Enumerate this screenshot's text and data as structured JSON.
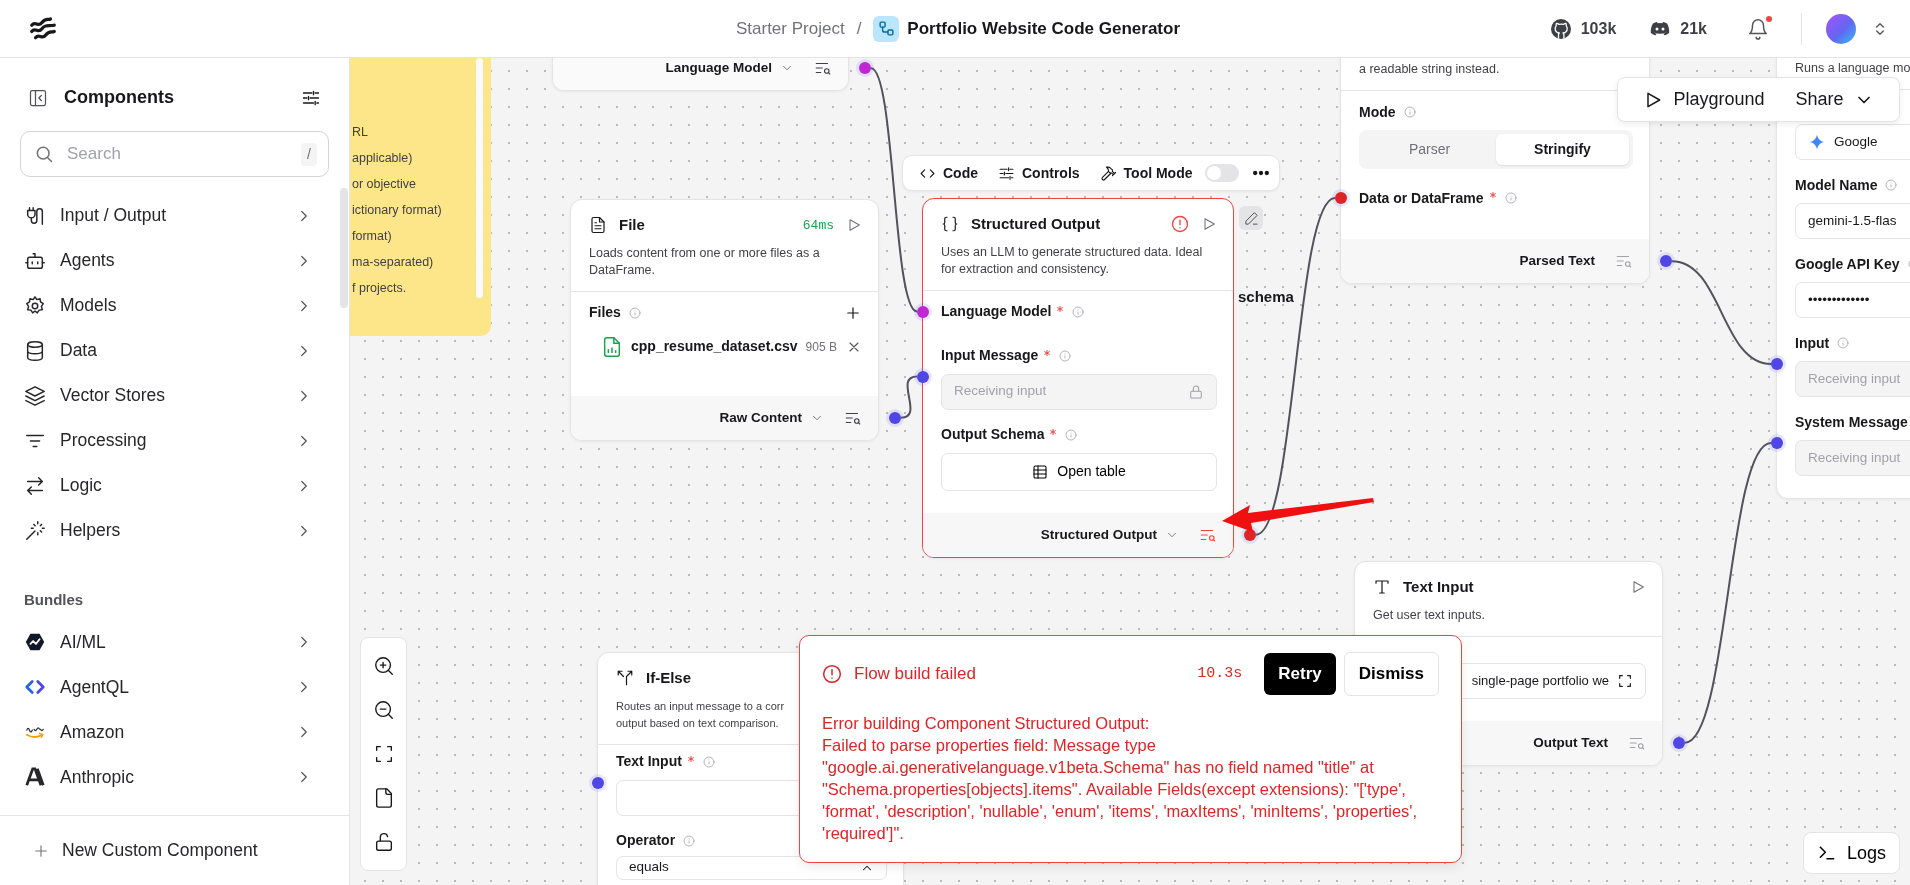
{
  "header": {
    "project": "Starter Project",
    "separator": "/",
    "flow_title": "Portfolio Website Code Generator",
    "github_count": "103k",
    "discord_count": "21k",
    "has_notification": true
  },
  "sidebar": {
    "title": "Components",
    "search": {
      "placeholder": "Search",
      "shortcut": "/"
    },
    "categories": [
      {
        "label": "Input / Output"
      },
      {
        "label": "Agents"
      },
      {
        "label": "Models"
      },
      {
        "label": "Data"
      },
      {
        "label": "Vector Stores"
      },
      {
        "label": "Processing"
      },
      {
        "label": "Logic"
      },
      {
        "label": "Helpers"
      }
    ],
    "bundles_title": "Bundles",
    "bundles": [
      {
        "label": "AI/ML"
      },
      {
        "label": "AgentQL"
      },
      {
        "label": "Amazon"
      },
      {
        "label": "Anthropic"
      }
    ],
    "new_component": "New Custom Component"
  },
  "canvas": {
    "note": {
      "lines": [
        "RL",
        "applicable)",
        "or objective",
        "ictionary format)",
        "format)",
        "ma-separated)",
        "f projects."
      ]
    },
    "toolbar": {
      "code": "Code",
      "controls": "Controls",
      "tool_mode": "Tool Mode",
      "tool_mode_on": false
    },
    "nodes": [
      {
        "output": {
          "label": "Language Model",
          "has_options": true,
          "color": "#c026d3"
        }
      },
      {
        "title": "File",
        "duration": "64ms",
        "runnable": true,
        "error": false,
        "description": [
          "Loads content from one or more files as a DataFrame."
        ],
        "fields": [
          {
            "kind": "files",
            "label": "Files",
            "info": true,
            "files": [
              {
                "name": "cpp_resume_dataset.csv",
                "size": "905 B"
              }
            ]
          }
        ],
        "output": {
          "label": "Raw Content",
          "has_options": true,
          "color": "#4f46e5"
        }
      },
      {
        "title": "Structured Output",
        "runnable": true,
        "error": true,
        "description": [
          "Uses an LLM to generate structured data. Ideal for extraction and consistency."
        ],
        "fields": [
          {
            "kind": "handle",
            "label": "Language Model",
            "required": true,
            "info": true,
            "color": "#c026d3"
          },
          {
            "kind": "input",
            "label": "Input Message",
            "required": true,
            "info": true,
            "placeholder": "Receiving input",
            "disabled": true,
            "locked": true,
            "color": "#4f46e5"
          },
          {
            "kind": "button",
            "label": "Output Schema",
            "required": true,
            "info": true,
            "button": "Open table"
          }
        ],
        "output": {
          "label": "Structured Output",
          "has_options": true,
          "color": "#dc2626"
        }
      },
      {
        "description": [
          "a readable string instead."
        ],
        "fields": [
          {
            "kind": "segmented",
            "label": "Mode",
            "info": true,
            "options": [
              {
                "label": "Parser",
                "selected": false
              },
              {
                "label": "Stringify",
                "selected": true
              }
            ]
          },
          {
            "kind": "handle",
            "label": "Data or DataFrame",
            "required": true,
            "info": true,
            "color": "#dc2626"
          }
        ],
        "output": {
          "label": "Parsed Text",
          "has_options": false,
          "color": "#4f46e5"
        }
      },
      {
        "description": [
          "Runs a language mo"
        ],
        "fields": [
          {
            "kind": "select",
            "value": "Google"
          },
          {
            "kind": "input",
            "label": "Model Name",
            "info": true,
            "value": "gemini-1.5-flas"
          },
          {
            "kind": "input",
            "label": "Google API Key",
            "info": true,
            "value": "•••••••••••••"
          },
          {
            "kind": "input",
            "label": "Input",
            "info": true,
            "placeholder": "Receiving input",
            "disabled": true,
            "color": "#4f46e5"
          },
          {
            "kind": "input",
            "label": "System Message",
            "placeholder": "Receiving input",
            "disabled": true,
            "color": "#4f46e5"
          }
        ]
      },
      {
        "title": "Text Input",
        "runnable": true,
        "error": false,
        "description": [
          "Get user text inputs."
        ],
        "fields": [
          {
            "kind": "input",
            "value": "single-page portfolio we",
            "expandable": true
          }
        ],
        "output": {
          "label": "Output Text",
          "has_options": false,
          "color": "#4f46e5"
        }
      },
      {
        "title": "If-Else",
        "runnable": false,
        "error": false,
        "description": [
          "Routes an input message to a corr",
          "output based on text comparison."
        ],
        "fields": [
          {
            "kind": "input",
            "label": "Text Input",
            "required": true,
            "info": true,
            "color": "#4f46e5"
          },
          {
            "kind": "select",
            "label": "Operator",
            "info": true,
            "value": "equals"
          }
        ]
      }
    ],
    "stray_label": "schema",
    "actions": {
      "playground": "Playground",
      "share": "Share"
    },
    "toast": {
      "title": "Flow build failed",
      "duration": "10.3s",
      "retry": "Retry",
      "dismiss": "Dismiss",
      "heading": "Error building Component Structured Output:",
      "message": "Failed to parse properties field: Message type \"google.ai.generativelanguage.v1beta.Schema\" has no field named \"title\" at \"Schema.properties[objects].items\". Available Fields(except extensions): \"['type', 'format', 'description', 'nullable', 'enum', 'items', 'maxItems', 'minItems', 'properties', 'required']\"."
    },
    "logs": "Logs"
  }
}
